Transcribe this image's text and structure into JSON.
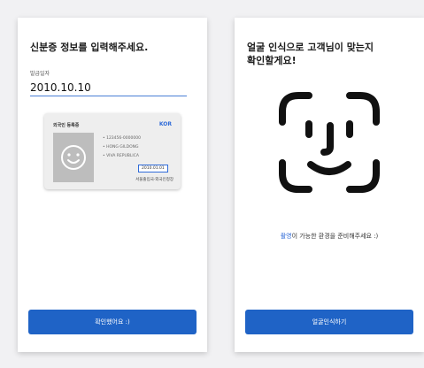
{
  "left": {
    "title": "신분증 정보를 입력해주세요.",
    "field_label": "발급일자",
    "field_value": "2010.10.10",
    "card": {
      "title": "외국인 등록증",
      "code": "KOR",
      "lines": [
        "• 123456-0000000",
        "• HONG GILDONG",
        "• VIVA REPUBLICA"
      ],
      "date": "2010.01.01",
      "issuer": "서울출입국·외국인청장"
    },
    "button_label": "확인했어요 :)"
  },
  "right": {
    "title_line1": "얼굴 인식으로 고객님이 맞는지",
    "title_line2": "확인할게요!",
    "message_accent": "촬영",
    "message_rest": "이 가능한 환경을 준비해주세요 :)",
    "button_label": "얼굴인식하기"
  },
  "colors": {
    "accent": "#1f63c6",
    "link": "#2f6bd8"
  },
  "icons": [
    "smiley-icon",
    "face-id-icon"
  ]
}
